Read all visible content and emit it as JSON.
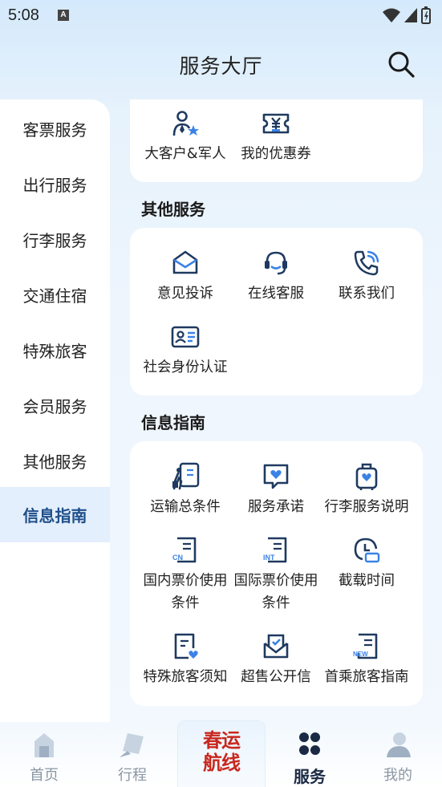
{
  "status_bar": {
    "time": "5:08",
    "a_icon": "A"
  },
  "header": {
    "title": "服务大厅",
    "search_icon": "search-icon"
  },
  "sidebar": {
    "items": [
      {
        "label": "客票服务"
      },
      {
        "label": "出行服务"
      },
      {
        "label": "行李服务"
      },
      {
        "label": "交通住宿"
      },
      {
        "label": "特殊旅客"
      },
      {
        "label": "会员服务"
      },
      {
        "label": "其他服务"
      },
      {
        "label": "信息指南",
        "active": true
      }
    ]
  },
  "member_card": {
    "items": [
      {
        "label": "大客户&军人",
        "icon": "vip-person-icon"
      },
      {
        "label": "我的优惠券",
        "icon": "coupon-icon"
      }
    ]
  },
  "other_services": {
    "title": "其他服务",
    "items": [
      {
        "label": "意见投诉",
        "icon": "complaint-mail-icon"
      },
      {
        "label": "在线客服",
        "icon": "headset-icon"
      },
      {
        "label": "联系我们",
        "icon": "phone-icon"
      },
      {
        "label": "社会身份认证",
        "icon": "id-card-icon"
      }
    ]
  },
  "info_guide": {
    "title": "信息指南",
    "items": [
      {
        "label": "运输总条件",
        "icon": "transport-terms-icon"
      },
      {
        "label": "服务承诺",
        "icon": "service-promise-icon"
      },
      {
        "label": "行李服务说明",
        "icon": "luggage-icon"
      },
      {
        "label": "国内票价使用",
        "label2": "条件",
        "icon": "cn-fare-icon",
        "badge": "CN"
      },
      {
        "label": "国际票价使用",
        "label2": "条件",
        "icon": "int-fare-icon",
        "badge": "INT"
      },
      {
        "label": "截载时间",
        "icon": "cutoff-clock-icon"
      },
      {
        "label": "特殊旅客须知",
        "icon": "special-notice-icon"
      },
      {
        "label": "超售公开信",
        "icon": "overbooking-letter-icon"
      },
      {
        "label": "首乘旅客指南",
        "icon": "new-passenger-icon",
        "badge": "NEW"
      }
    ]
  },
  "tabbar": {
    "tabs": [
      {
        "label": "首页",
        "icon": "home-icon"
      },
      {
        "label": "行程",
        "icon": "itinerary-icon"
      },
      {
        "label": "服务",
        "icon": "service-icon",
        "active": true
      },
      {
        "label": "我的",
        "icon": "profile-icon"
      }
    ],
    "promo": {
      "line1": "春运",
      "line2": "航线"
    }
  },
  "colors": {
    "accent": "#1f4f8a",
    "icon_blue": "#2a6fd6",
    "promo_red": "#c8281e"
  }
}
